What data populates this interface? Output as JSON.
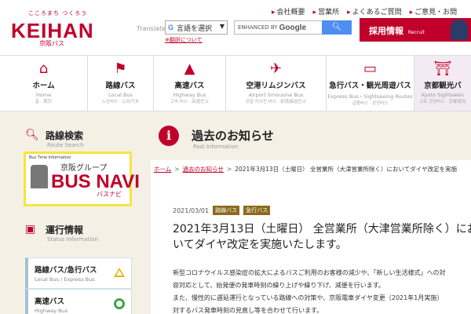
{
  "brand": {
    "tagline": "こころまち つくろう",
    "name": "KEIHAN",
    "sub": "京阪バス"
  },
  "topnav": [
    "会社概要",
    "営業所",
    "よくあるご質問",
    "ご意見・お問"
  ],
  "translate": {
    "label": "Translate",
    "select_label": "言語を選択",
    "note": "※翻訳について"
  },
  "search": {
    "prefix": "ENHANCED BY",
    "engine": "Google"
  },
  "recruit": {
    "label": "採用情報",
    "en": "Recruit"
  },
  "mainnav": [
    {
      "label": "ホーム",
      "en": "Home",
      "kr": "홈 · 首页"
    },
    {
      "label": "路線バス",
      "en": "Local Bus",
      "kr": "노선버스 · 公共汽车"
    },
    {
      "label": "高速バス",
      "en": "Highway Bus",
      "kr": "고속 버스 · 高速巴士"
    },
    {
      "label": "空港リムジンバス",
      "en": "Airport limousine Bus",
      "kr": "공항 리무진 버스 · 机场接送巴士"
    },
    {
      "label": "急行バス・観光周遊バス",
      "en": "Express Bus・Sightseeing Routes",
      "kr": "급행버스 · 관광버스"
    },
    {
      "label": "京都観光バ",
      "en": "Kyoto Sightseein",
      "kr": "교토 관광버스 · 京都观光"
    }
  ],
  "sidebar": {
    "route_search": {
      "title": "路線検索",
      "en": "Route Search"
    },
    "busnavi": {
      "info": "Bus Time Information",
      "group": "京阪グループ",
      "name": "BUS NAVI",
      "jp": "バスナビ"
    },
    "operation": {
      "title": "運行情報",
      "en": "Status Information"
    },
    "status": [
      {
        "label": "路線バス/急行バス",
        "en": "Local Bus / Express Bus"
      },
      {
        "label": "高速バス",
        "en": "Highway Bus"
      }
    ]
  },
  "page": {
    "title": "過去のお知らせ",
    "en": "Past Information"
  },
  "breadcrumb": [
    "ホーム",
    "過去のお知らせ",
    "2021年3月13日（土曜日） 全営業所（大津営業所除く）においてダイヤ改定を実施"
  ],
  "article": {
    "date": "2021/03/01",
    "tags": [
      "路線バス",
      "急行バス"
    ],
    "title": "2021年3月13日（土曜日） 全営業所（大津営業所除く）においてダイヤ改定を実施いたします。",
    "body": [
      "新型コロナウイルス感染症の拡大によるバスご利用のお客様の減少や、「新しい生活様式」への対",
      "容対応として、始発便の発車時刻の繰り上げや繰り下げ、減便を行います。",
      "また、慢性的に遅延運行となっている路線への対策や、京阪電車ダイヤ変更（2021年1月実施）",
      "対するバス発車時刻の見直し等を合わせて行います。"
    ]
  }
}
